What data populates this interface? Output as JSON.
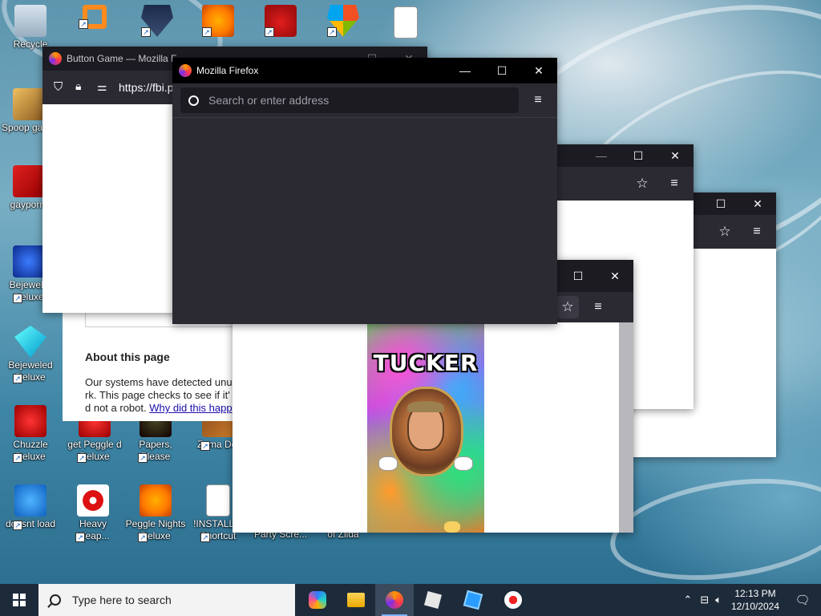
{
  "desktop": {
    "icons": [
      {
        "label": "Recycle",
        "icon": "recycle-bin-icon"
      },
      {
        "label": "",
        "icon": "search-app-icon"
      },
      {
        "label": "",
        "icon": "hockey-shield-icon"
      },
      {
        "label": "",
        "icon": "peggle-icon"
      },
      {
        "label": "",
        "icon": "angry-birds-icon"
      },
      {
        "label": "",
        "icon": "windows-shield-icon"
      },
      {
        "label": "",
        "icon": "document-icon"
      },
      {
        "label": "Spoop game",
        "icon": "spooky-game-icon"
      },
      {
        "label": "gayporn.",
        "icon": "flash-icon"
      },
      {
        "label": "Bejewele Deluxe",
        "icon": "bejeweled2-icon"
      },
      {
        "label": "Bejeweled Deluxe",
        "icon": "bejeweled-icon"
      },
      {
        "label": "Chuzzle Deluxe",
        "icon": "chuzzle-icon"
      },
      {
        "label": "get Peggle d Deluxe",
        "icon": "peggle-deluxe-icon"
      },
      {
        "label": "Papers, Please",
        "icon": "papers-please-icon"
      },
      {
        "label": "Zuma Del",
        "icon": "zuma-icon"
      },
      {
        "label": "doesnt load",
        "icon": "twitter-bird-icon"
      },
      {
        "label": "Heavy Weap...",
        "icon": "heavy-weapon-icon"
      },
      {
        "label": "Peggle Nights Deluxe",
        "icon": "peggle-nights-icon"
      },
      {
        "label": "!INSTALLI - Shortcut",
        "icon": "install-shortcut-icon"
      },
      {
        "label": "Party Scre...",
        "icon": "party-icon"
      },
      {
        "label": "of Zilda",
        "icon": "zilda-icon"
      }
    ]
  },
  "windows": {
    "button_game": {
      "title": "Button Game — Mozilla F",
      "url": "https://fbi.p"
    },
    "main": {
      "title": "Mozilla Firefox",
      "search_placeholder": "Search or enter address",
      "minimize": "—",
      "maximize": "☐",
      "close": "✕",
      "menu": "≡"
    },
    "captcha": {
      "heading": "About this page",
      "line1": "Our systems have detected unu",
      "line2": "rk. This page checks to see if it'",
      "line3_prefix": "d not a robot. ",
      "link": "Why did this happ"
    },
    "tucker": {
      "title": "TUCKER"
    }
  },
  "taskbar": {
    "search_placeholder": "Type here to search",
    "apps": [
      {
        "name": "copilot-icon"
      },
      {
        "name": "file-explorer-icon"
      },
      {
        "name": "firefox-icon"
      },
      {
        "name": "roblox-icon"
      },
      {
        "name": "roblox-studio-icon"
      },
      {
        "name": "record-icon"
      }
    ],
    "time": "12:13 PM",
    "date": "12/10/2024"
  }
}
